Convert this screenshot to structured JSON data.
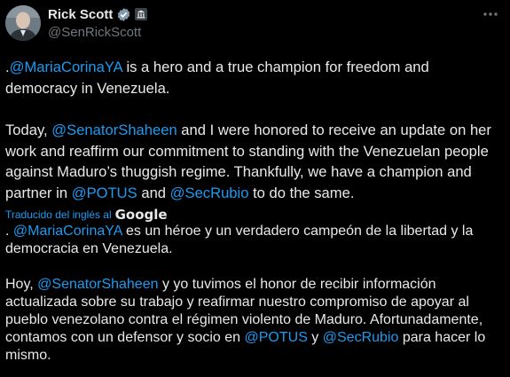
{
  "author": {
    "name": "Rick Scott",
    "handle": "@SenRickScott"
  },
  "icons": {
    "verified": "verified-badge-icon",
    "government": "government-building-icon",
    "more": "more-options-icon"
  },
  "tweet": {
    "p1": {
      "prefix": ".",
      "mention1": "@MariaCorinaYA",
      "rest": " is a hero and a true champion for freedom and democracy in Venezuela."
    },
    "p2": {
      "start": "Today, ",
      "mention1": "@SenatorShaheen",
      "mid1": " and I were honored to receive an update on her work and reaffirm our commitment to standing with the Venezuelan people against Maduro’s thuggish regime. Thankfully, we have a champion and partner in ",
      "mention2": "@POTUS",
      "mid2": " and ",
      "mention3": "@SecRubio",
      "end": " to do the same."
    }
  },
  "translation": {
    "label": "Traducido del inglés al",
    "provider": "Google",
    "p1": {
      "prefix": ". ",
      "mention1": "@MariaCorinaYA",
      "rest": " es un héroe y un verdadero campeón de la libertad y la democracia en Venezuela."
    },
    "p2": {
      "start": "Hoy, ",
      "mention1": "@SenatorShaheen",
      "mid1": " y yo tuvimos el honor de recibir información actualizada sobre su trabajo y reafirmar nuestro compromiso de apoyar al pueblo venezolano contra el régimen violento de Maduro. Afortunadamente, contamos con un defensor y socio en ",
      "mention2": "@POTUS",
      "mid2": " y ",
      "mention3": "@SecRubio",
      "end": " para hacer lo mismo."
    }
  },
  "colors": {
    "background": "#000000",
    "text": "#e7e9ea",
    "link": "#1d9bf0",
    "secondary": "#71767b"
  }
}
